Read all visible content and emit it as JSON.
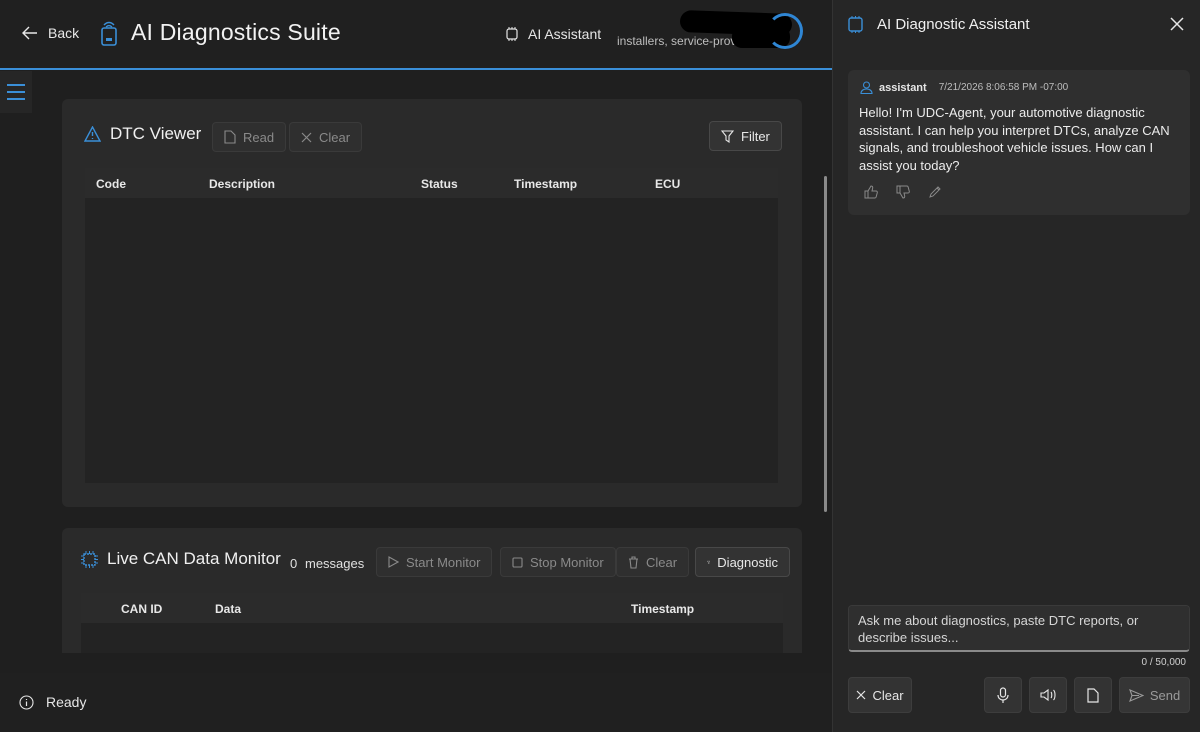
{
  "header": {
    "back_label": "Back",
    "app_title": "AI Diagnostics Suite",
    "ai_assistant_label": "AI Assistant",
    "user_subtitle": "installers, service-providers"
  },
  "dtc": {
    "title": "DTC Viewer",
    "read_label": "Read",
    "clear_label": "Clear",
    "filter_label": "Filter",
    "columns": [
      "Code",
      "Description",
      "Status",
      "Timestamp",
      "ECU"
    ]
  },
  "can": {
    "title": "Live CAN Data Monitor",
    "count": "0",
    "count_label": "messages",
    "start_label": "Start Monitor",
    "stop_label": "Stop Monitor",
    "clear_label": "Clear",
    "diagnostics_label": "Diagnostic",
    "columns": [
      "CAN ID",
      "Data",
      "Timestamp"
    ]
  },
  "status": {
    "text": "Ready"
  },
  "assistant": {
    "title": "AI Diagnostic Assistant",
    "message": {
      "role": "assistant",
      "time": "7/21/2026 8:06:58 PM -07:00",
      "text": "Hello! I'm UDC-Agent, your automotive diagnostic assistant. I can help you interpret DTCs, analyze CAN signals, and troubleshoot vehicle issues. How can I assist you today?"
    },
    "input_placeholder": "Ask me about diagnostics, paste DTC reports, or describe issues...",
    "char_count": "0 / 50,000",
    "clear_label": "Clear",
    "send_label": "Send"
  },
  "colors": {
    "accent": "#3a8fd8",
    "background": "#1f1f1f",
    "card": "#2a2a2a"
  },
  "icons": [
    "back-arrow-icon",
    "app-device-icon",
    "chip-icon",
    "warning-icon",
    "document-icon",
    "close-icon",
    "filter-icon",
    "play-icon",
    "stop-icon",
    "trash-icon",
    "info-icon",
    "person-icon",
    "thumbs-up-icon",
    "thumbs-down-icon",
    "pencil-icon",
    "microphone-icon",
    "speaker-icon",
    "send-icon"
  ]
}
